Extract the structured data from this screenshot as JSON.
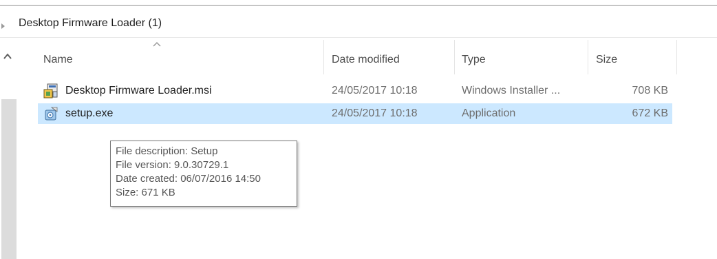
{
  "group": {
    "title": "Desktop Firmware Loader (1)"
  },
  "columns": [
    {
      "label": "Name"
    },
    {
      "label": "Date modified"
    },
    {
      "label": "Type"
    },
    {
      "label": "Size"
    }
  ],
  "files": [
    {
      "name": "Desktop Firmware Loader.msi",
      "date": "24/05/2017 10:18",
      "type": "Windows Installer ...",
      "size": "708 KB",
      "icon": "installer-package-icon",
      "selected": false
    },
    {
      "name": "setup.exe",
      "date": "24/05/2017 10:18",
      "type": "Application",
      "size": "672 KB",
      "icon": "setup-application-icon",
      "selected": true
    }
  ],
  "tooltip": {
    "lines": [
      "File description: Setup",
      "File version: 9.0.30729.1",
      "Date created: 06/07/2016 14:50",
      "Size: 671 KB"
    ]
  },
  "colors": {
    "selection": "#cce8ff",
    "header_text": "#4d4d4d",
    "meta_text": "#6d6d6d"
  }
}
